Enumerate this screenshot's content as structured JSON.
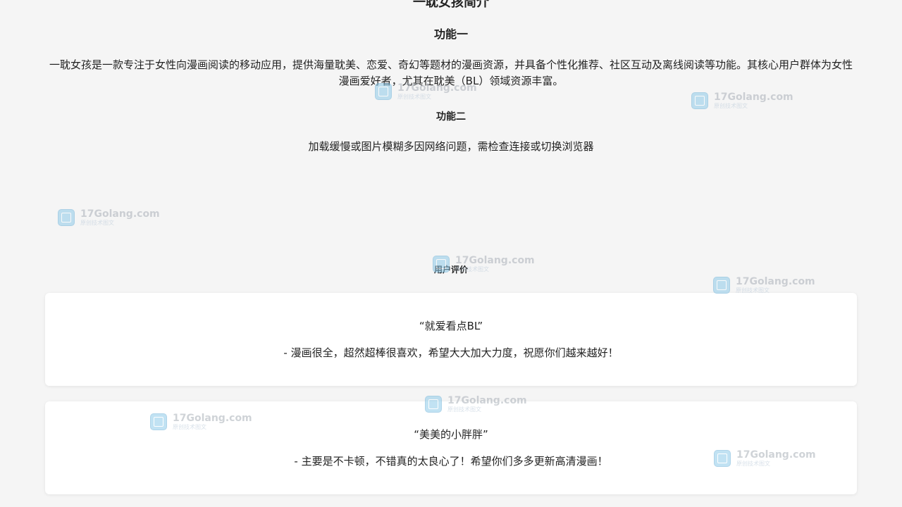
{
  "intro": {
    "title": "一耽女孩简介",
    "section1_title": "功能一",
    "section1_text": "一耽女孩是一款专注于女性向漫画阅读的移动应用，提供海量耽美、恋爱、奇幻等题材的漫画资源，并具备个性化推荐、社区互动及离线阅读等功能。其核心用户群体为女性漫画爱好者，尤其在耽美（BL）领域资源丰富。",
    "section2_title": "功能二",
    "section2_text": "加载缓慢或图片模糊多因网络问题，需检查连接或切换浏览器"
  },
  "reviews": {
    "heading": "用户评价",
    "items": [
      {
        "title": "“就爱看点BL”",
        "text": "- 漫画很全，超然超棒很喜欢，希望大大加大力度，祝愿你们越来越好！"
      },
      {
        "title": "“美美的小胖胖”",
        "text": "- 主要是不卡顿，不错真的太良心了！希望你们多多更新高清漫画！"
      }
    ]
  },
  "watermark": {
    "name": "17Golang.com",
    "subtitle": "原创技术图文"
  }
}
